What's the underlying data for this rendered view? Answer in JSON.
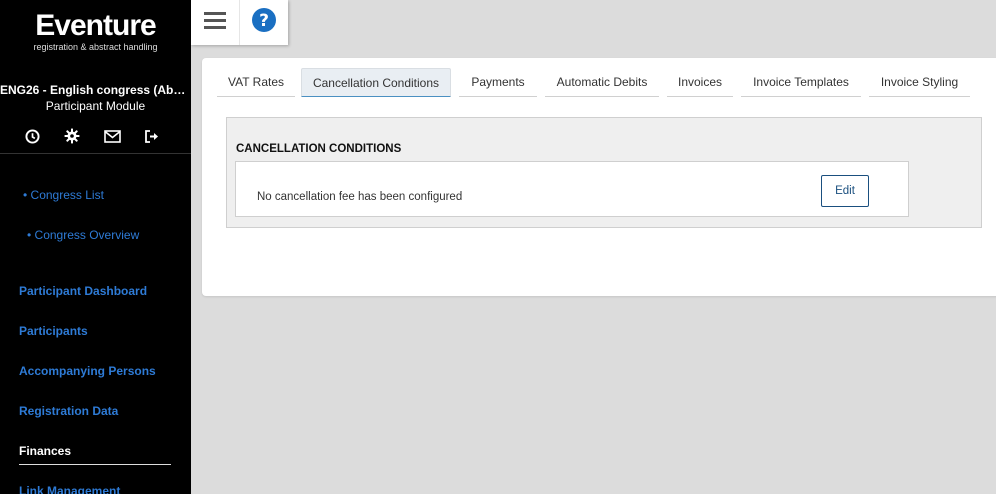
{
  "sidebar": {
    "logo_title": "Eventure",
    "logo_subtitle": "registration & abstract handling",
    "congress_title": "ENG26 - English congress (Abstrac...",
    "congress_module": "Participant Module",
    "icons": [
      "clock-icon",
      "gear-icon",
      "mail-icon",
      "logout-icon"
    ],
    "top_links": [
      "• Congress List",
      "• Congress Overview"
    ],
    "links": [
      "Participant Dashboard",
      "Participants",
      "Accompanying Persons",
      "Registration Data"
    ],
    "active": "Finances",
    "after_links": [
      "Link Management"
    ]
  },
  "topbar": {
    "icons": [
      "menu-icon",
      "help-icon"
    ]
  },
  "tabs": [
    "VAT Rates",
    "Cancellation Conditions",
    "Payments",
    "Automatic Debits",
    "Invoices",
    "Invoice Templates",
    "Invoice Styling"
  ],
  "active_tab": "Cancellation Conditions",
  "panel": {
    "title": "CANCELLATION CONDITIONS",
    "message": "No cancellation fee has been configured",
    "edit_label": "Edit"
  },
  "colors": {
    "sidebar_bg": "#000000",
    "link": "#2e7bd6",
    "help_icon": "#1a6fc2",
    "background": "#dcdcdc"
  }
}
